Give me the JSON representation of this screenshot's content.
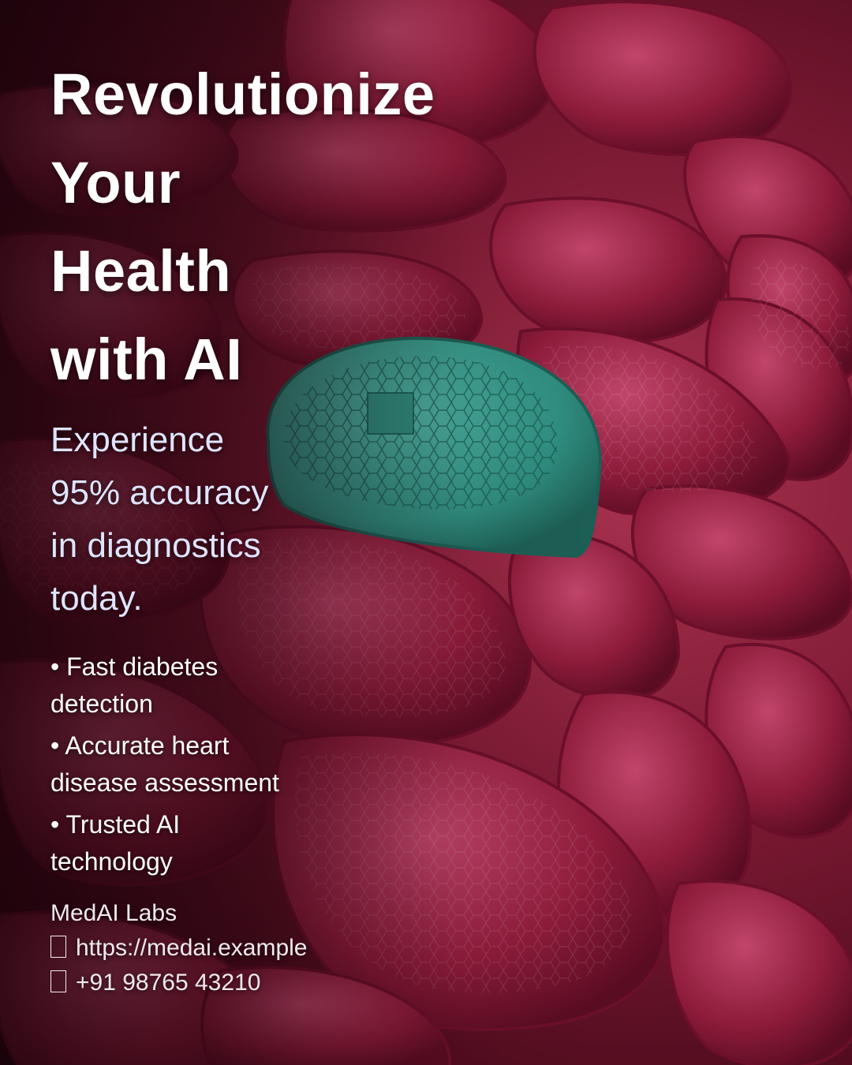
{
  "headline": {
    "lines": [
      "Revolutionize",
      "Your",
      "Health",
      "with AI"
    ]
  },
  "subhead": {
    "lines": [
      "Experience",
      "95% accuracy",
      "in diagnostics",
      "today."
    ]
  },
  "features": [
    {
      "lines": [
        "• Fast diabetes",
        "detection"
      ]
    },
    {
      "lines": [
        "• Accurate heart",
        "disease assessment"
      ]
    },
    {
      "lines": [
        "• Trusted AI",
        "technology"
      ]
    }
  ],
  "footer": {
    "brand": "MedAI Labs",
    "website": "https://medai.example",
    "phone": "+91 98765 43210",
    "website_icon": "globe-icon",
    "phone_icon": "phone-icon"
  },
  "colors": {
    "background_picks": "#8e1c3a",
    "highlight_pick": "#2f8d7f",
    "subhead_text": "#dfe4ff"
  }
}
